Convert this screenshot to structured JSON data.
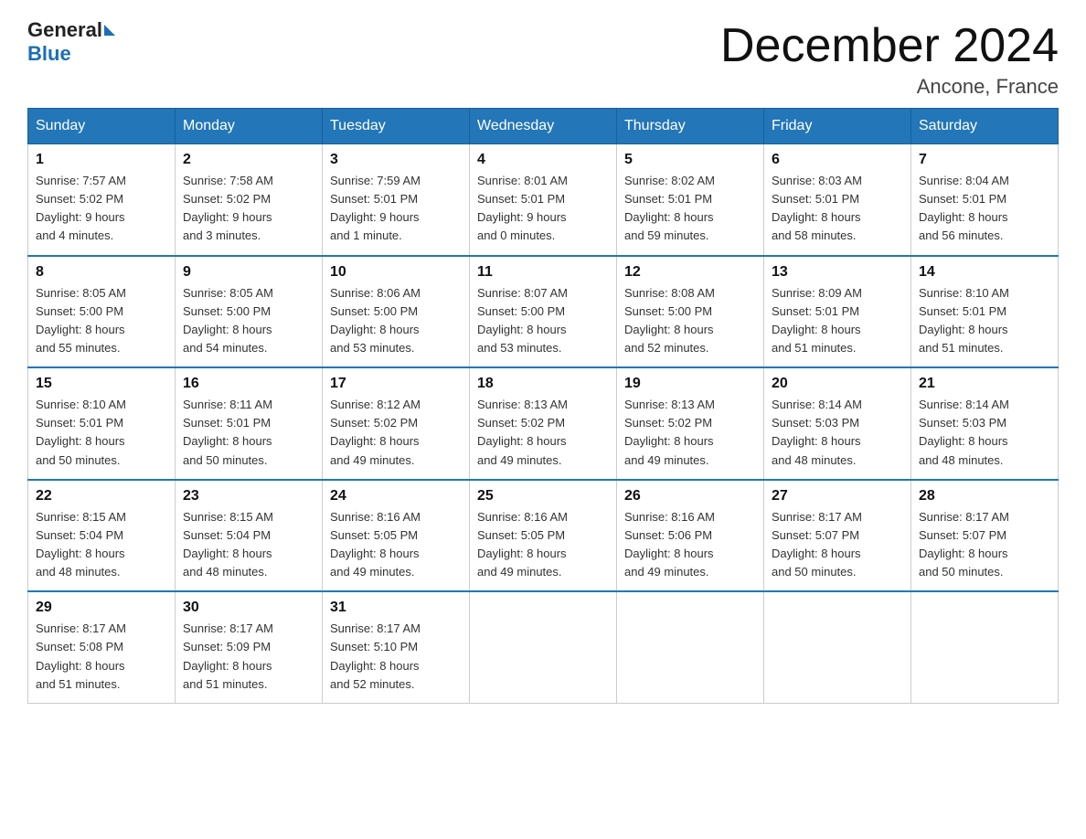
{
  "logo": {
    "text_general": "General",
    "text_blue": "Blue"
  },
  "title": "December 2024",
  "subtitle": "Ancone, France",
  "headers": [
    "Sunday",
    "Monday",
    "Tuesday",
    "Wednesday",
    "Thursday",
    "Friday",
    "Saturday"
  ],
  "weeks": [
    [
      {
        "day": "1",
        "info": "Sunrise: 7:57 AM\nSunset: 5:02 PM\nDaylight: 9 hours\nand 4 minutes."
      },
      {
        "day": "2",
        "info": "Sunrise: 7:58 AM\nSunset: 5:02 PM\nDaylight: 9 hours\nand 3 minutes."
      },
      {
        "day": "3",
        "info": "Sunrise: 7:59 AM\nSunset: 5:01 PM\nDaylight: 9 hours\nand 1 minute."
      },
      {
        "day": "4",
        "info": "Sunrise: 8:01 AM\nSunset: 5:01 PM\nDaylight: 9 hours\nand 0 minutes."
      },
      {
        "day": "5",
        "info": "Sunrise: 8:02 AM\nSunset: 5:01 PM\nDaylight: 8 hours\nand 59 minutes."
      },
      {
        "day": "6",
        "info": "Sunrise: 8:03 AM\nSunset: 5:01 PM\nDaylight: 8 hours\nand 58 minutes."
      },
      {
        "day": "7",
        "info": "Sunrise: 8:04 AM\nSunset: 5:01 PM\nDaylight: 8 hours\nand 56 minutes."
      }
    ],
    [
      {
        "day": "8",
        "info": "Sunrise: 8:05 AM\nSunset: 5:00 PM\nDaylight: 8 hours\nand 55 minutes."
      },
      {
        "day": "9",
        "info": "Sunrise: 8:05 AM\nSunset: 5:00 PM\nDaylight: 8 hours\nand 54 minutes."
      },
      {
        "day": "10",
        "info": "Sunrise: 8:06 AM\nSunset: 5:00 PM\nDaylight: 8 hours\nand 53 minutes."
      },
      {
        "day": "11",
        "info": "Sunrise: 8:07 AM\nSunset: 5:00 PM\nDaylight: 8 hours\nand 53 minutes."
      },
      {
        "day": "12",
        "info": "Sunrise: 8:08 AM\nSunset: 5:00 PM\nDaylight: 8 hours\nand 52 minutes."
      },
      {
        "day": "13",
        "info": "Sunrise: 8:09 AM\nSunset: 5:01 PM\nDaylight: 8 hours\nand 51 minutes."
      },
      {
        "day": "14",
        "info": "Sunrise: 8:10 AM\nSunset: 5:01 PM\nDaylight: 8 hours\nand 51 minutes."
      }
    ],
    [
      {
        "day": "15",
        "info": "Sunrise: 8:10 AM\nSunset: 5:01 PM\nDaylight: 8 hours\nand 50 minutes."
      },
      {
        "day": "16",
        "info": "Sunrise: 8:11 AM\nSunset: 5:01 PM\nDaylight: 8 hours\nand 50 minutes."
      },
      {
        "day": "17",
        "info": "Sunrise: 8:12 AM\nSunset: 5:02 PM\nDaylight: 8 hours\nand 49 minutes."
      },
      {
        "day": "18",
        "info": "Sunrise: 8:13 AM\nSunset: 5:02 PM\nDaylight: 8 hours\nand 49 minutes."
      },
      {
        "day": "19",
        "info": "Sunrise: 8:13 AM\nSunset: 5:02 PM\nDaylight: 8 hours\nand 49 minutes."
      },
      {
        "day": "20",
        "info": "Sunrise: 8:14 AM\nSunset: 5:03 PM\nDaylight: 8 hours\nand 48 minutes."
      },
      {
        "day": "21",
        "info": "Sunrise: 8:14 AM\nSunset: 5:03 PM\nDaylight: 8 hours\nand 48 minutes."
      }
    ],
    [
      {
        "day": "22",
        "info": "Sunrise: 8:15 AM\nSunset: 5:04 PM\nDaylight: 8 hours\nand 48 minutes."
      },
      {
        "day": "23",
        "info": "Sunrise: 8:15 AM\nSunset: 5:04 PM\nDaylight: 8 hours\nand 48 minutes."
      },
      {
        "day": "24",
        "info": "Sunrise: 8:16 AM\nSunset: 5:05 PM\nDaylight: 8 hours\nand 49 minutes."
      },
      {
        "day": "25",
        "info": "Sunrise: 8:16 AM\nSunset: 5:05 PM\nDaylight: 8 hours\nand 49 minutes."
      },
      {
        "day": "26",
        "info": "Sunrise: 8:16 AM\nSunset: 5:06 PM\nDaylight: 8 hours\nand 49 minutes."
      },
      {
        "day": "27",
        "info": "Sunrise: 8:17 AM\nSunset: 5:07 PM\nDaylight: 8 hours\nand 50 minutes."
      },
      {
        "day": "28",
        "info": "Sunrise: 8:17 AM\nSunset: 5:07 PM\nDaylight: 8 hours\nand 50 minutes."
      }
    ],
    [
      {
        "day": "29",
        "info": "Sunrise: 8:17 AM\nSunset: 5:08 PM\nDaylight: 8 hours\nand 51 minutes."
      },
      {
        "day": "30",
        "info": "Sunrise: 8:17 AM\nSunset: 5:09 PM\nDaylight: 8 hours\nand 51 minutes."
      },
      {
        "day": "31",
        "info": "Sunrise: 8:17 AM\nSunset: 5:10 PM\nDaylight: 8 hours\nand 52 minutes."
      },
      {
        "day": "",
        "info": ""
      },
      {
        "day": "",
        "info": ""
      },
      {
        "day": "",
        "info": ""
      },
      {
        "day": "",
        "info": ""
      }
    ]
  ]
}
